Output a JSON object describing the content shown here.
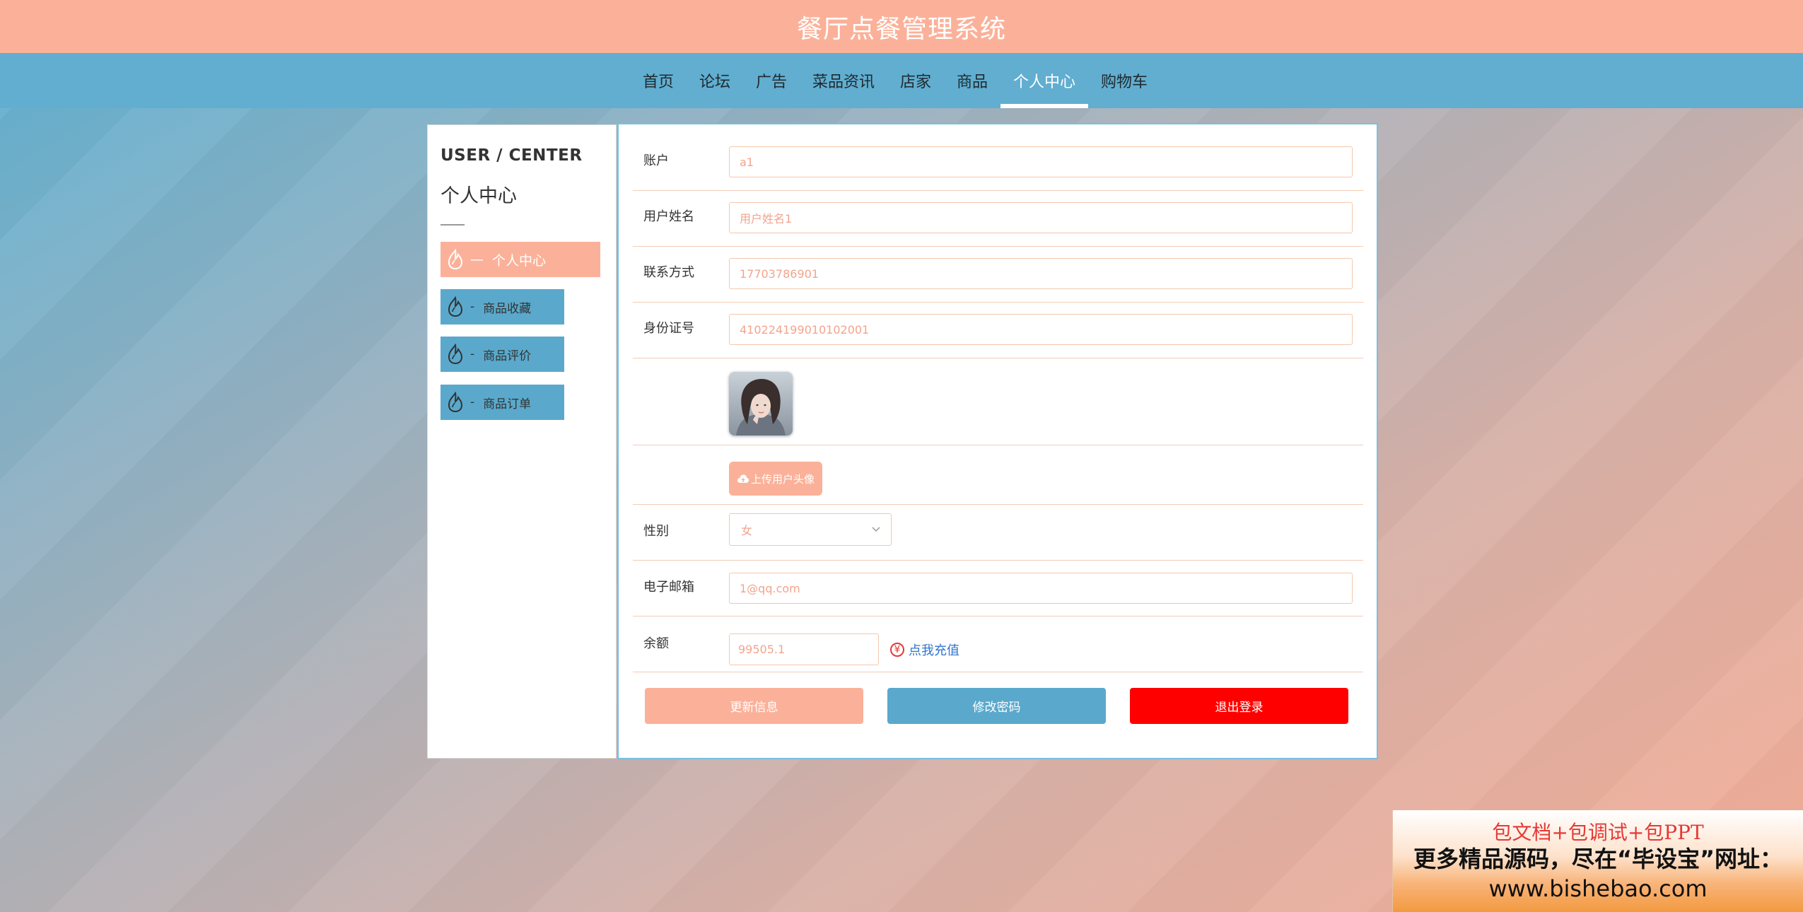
{
  "header": {
    "title": "餐厅点餐管理系统"
  },
  "nav": {
    "items": [
      {
        "label": "首页",
        "active": false
      },
      {
        "label": "论坛",
        "active": false
      },
      {
        "label": "广告",
        "active": false
      },
      {
        "label": "菜品资讯",
        "active": false
      },
      {
        "label": "店家",
        "active": false
      },
      {
        "label": "商品",
        "active": false
      },
      {
        "label": "个人中心",
        "active": true
      },
      {
        "label": "购物车",
        "active": false
      }
    ]
  },
  "sidebar": {
    "title_en": "USER / CENTER",
    "title_cn": "个人中心",
    "items": [
      {
        "label": "个人中心",
        "active": true,
        "sep": "—",
        "icon": "flame-icon"
      },
      {
        "label": "商品收藏",
        "active": false,
        "sep": "-",
        "icon": "flame-icon"
      },
      {
        "label": "商品评价",
        "active": false,
        "sep": "-",
        "icon": "flame-icon"
      },
      {
        "label": "商品订单",
        "active": false,
        "sep": "-",
        "icon": "flame-icon"
      }
    ]
  },
  "form": {
    "account": {
      "label": "账户",
      "value": "a1"
    },
    "username": {
      "label": "用户姓名",
      "value": "用户姓名1"
    },
    "phone": {
      "label": "联系方式",
      "value": "17703786901"
    },
    "idcard": {
      "label": "身份证号",
      "value": "410224199010102001"
    },
    "avatar": {
      "alt": "user avatar"
    },
    "upload": {
      "label": "上传用户头像",
      "icon": "cloud-upload-icon"
    },
    "gender": {
      "label": "性别",
      "value": "女"
    },
    "email": {
      "label": "电子邮箱",
      "value": "1@qq.com"
    },
    "balance": {
      "label": "余额",
      "value": "99505.1",
      "recharge_label": "点我充值",
      "recharge_icon": "yen-icon"
    }
  },
  "buttons": {
    "update": "更新信息",
    "change_password": "修改密码",
    "logout": "退出登录"
  },
  "colors": {
    "header": "#fbb199",
    "nav": "#61aed0",
    "accent_blue": "#5aa9cc",
    "logout_red": "#ff0000",
    "link_blue": "#2f74d0"
  },
  "watermark": {
    "line1": "包文档+包调试+包PPT",
    "line2": "更多精品源码，尽在“毕设宝”网址：",
    "line3": "www.bishebao.com"
  }
}
